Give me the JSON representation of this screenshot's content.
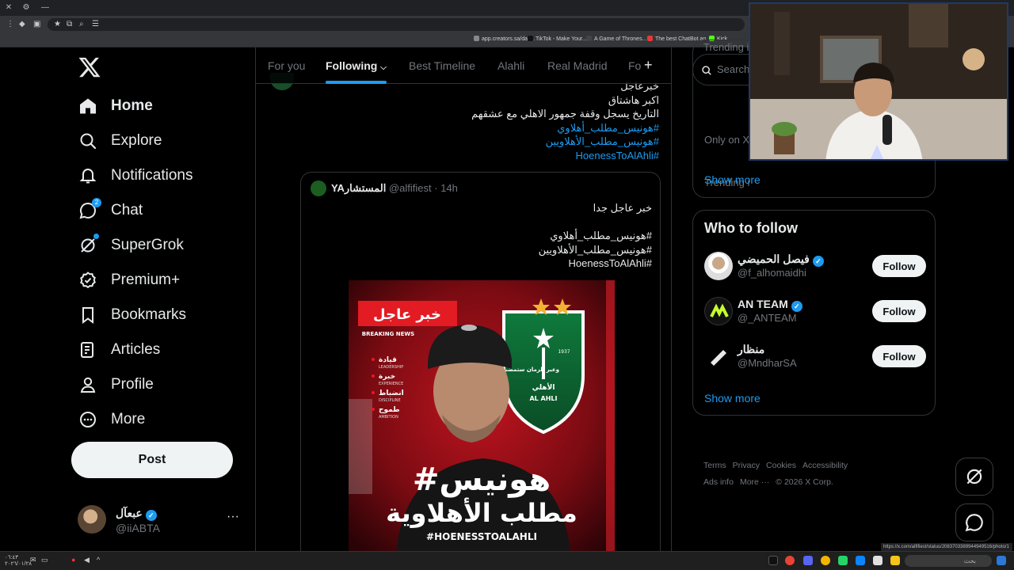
{
  "browser": {
    "bookmarks": [
      {
        "label": "app.creators.sa/das...",
        "color": "#888888"
      },
      {
        "label": "TikTok - Make Your...",
        "color": "#111111"
      },
      {
        "label": "A Game of Thrones...",
        "color": "#333333"
      },
      {
        "label": "The best ChatBot an...",
        "color": "#e53935"
      },
      {
        "label": "Kick",
        "color": "#53fc18"
      }
    ],
    "status_url": "https://x.com/alfifiest/status/2083703389944949516/photo/1"
  },
  "nav": {
    "items": [
      {
        "label": "Home",
        "icon": "home-icon"
      },
      {
        "label": "Explore",
        "icon": "search-icon"
      },
      {
        "label": "Notifications",
        "icon": "bell-icon"
      },
      {
        "label": "Chat",
        "icon": "chat-icon",
        "badge": "2"
      },
      {
        "label": "SuperGrok",
        "icon": "grok-icon"
      },
      {
        "label": "Premium+",
        "icon": "premium-icon"
      },
      {
        "label": "Bookmarks",
        "icon": "bookmark-icon"
      },
      {
        "label": "Articles",
        "icon": "article-icon"
      },
      {
        "label": "Profile",
        "icon": "person-icon"
      },
      {
        "label": "More",
        "icon": "more-circle-icon"
      }
    ],
    "post_label": "Post",
    "account": {
      "name": "عبعآل",
      "handle": "@iiABTA",
      "more": "···"
    }
  },
  "tabs": [
    "For you",
    "Following",
    "Best Timeline",
    "Alahli",
    "Real Madrid",
    "Fo"
  ],
  "tabs_active": "Following",
  "tab_add": "+",
  "tweet": {
    "lines": [
      {
        "text": "خبرعاجل",
        "type": "plain"
      },
      {
        "text": "اكبر هاشتاق",
        "type": "plain"
      },
      {
        "text": "التاريخ يسجل وقفة جمهور الاهلي مع عشقهم",
        "type": "plain"
      },
      {
        "text": "#هونيس_مطلب_أهلاوي",
        "type": "hash"
      },
      {
        "text": "#هونيس_مطلب_الأهلاويين",
        "type": "hash"
      },
      {
        "text": "#HoenessToAlAhli",
        "type": "hash"
      }
    ]
  },
  "quote": {
    "name": "YAالمستشار",
    "handle": "@alfifiest",
    "time": "· 14h",
    "lines": [
      "خبر عاجل جدا",
      "",
      "#هونيس_مطلب_أهلاوي",
      "#هونيس_مطلب_الأهلاويين",
      "#HoenessToAlAhli"
    ]
  },
  "poster": {
    "breaking_ar": "خبر عاجل",
    "breaking_en": "BREAKING NEWS",
    "qualities": [
      {
        "ar": "قيادة",
        "en": "LEADERSHIP"
      },
      {
        "ar": "خبرة",
        "en": "EXPERIENCE"
      },
      {
        "ar": "انضباط",
        "en": "DISCIPLINE"
      },
      {
        "ar": "طموح",
        "en": "AMBITION"
      }
    ],
    "headline_1": "#هونيس",
    "headline_2": "مطلب الأهلاوية",
    "hashtag": "#HOENESSTOALAHLI",
    "crest_year": "1937",
    "crest_text": "وعبر الزمان ستمضي",
    "crest_club_ar": "الأهلي",
    "crest_club_en": "AL AHLI"
  },
  "right": {
    "search_placeholder": "Search",
    "trend_top": "Trending i",
    "only_on": "Only on X",
    "trending2": "Trending i",
    "show_more": "Show more",
    "wtf": {
      "title": "Who to follow",
      "people": [
        {
          "name": "فيصل الحميضي",
          "handle": "@f_alhomaidhi",
          "verified": true,
          "follow": "Follow"
        },
        {
          "name": "AN TEAM",
          "handle": "@_ANTEAM",
          "verified": true,
          "follow": "Follow"
        },
        {
          "name": "منظار",
          "handle": "@MndharSA",
          "verified": false,
          "follow": "Follow"
        }
      ],
      "show_more": "Show more"
    },
    "footer": [
      "Terms",
      "Privacy",
      "Cookies",
      "Accessibility",
      "Ads info",
      "More ···",
      "© 2026 X Corp."
    ]
  },
  "taskbar": {
    "time": "٠٦:٤٣",
    "date": "٢٠٢٦/٠١/٢٨",
    "search_placeholder": "بحث"
  },
  "colors": {
    "accent": "#1d9bf0",
    "bg": "#000000",
    "border": "#2f3336",
    "muted": "#71767b"
  }
}
